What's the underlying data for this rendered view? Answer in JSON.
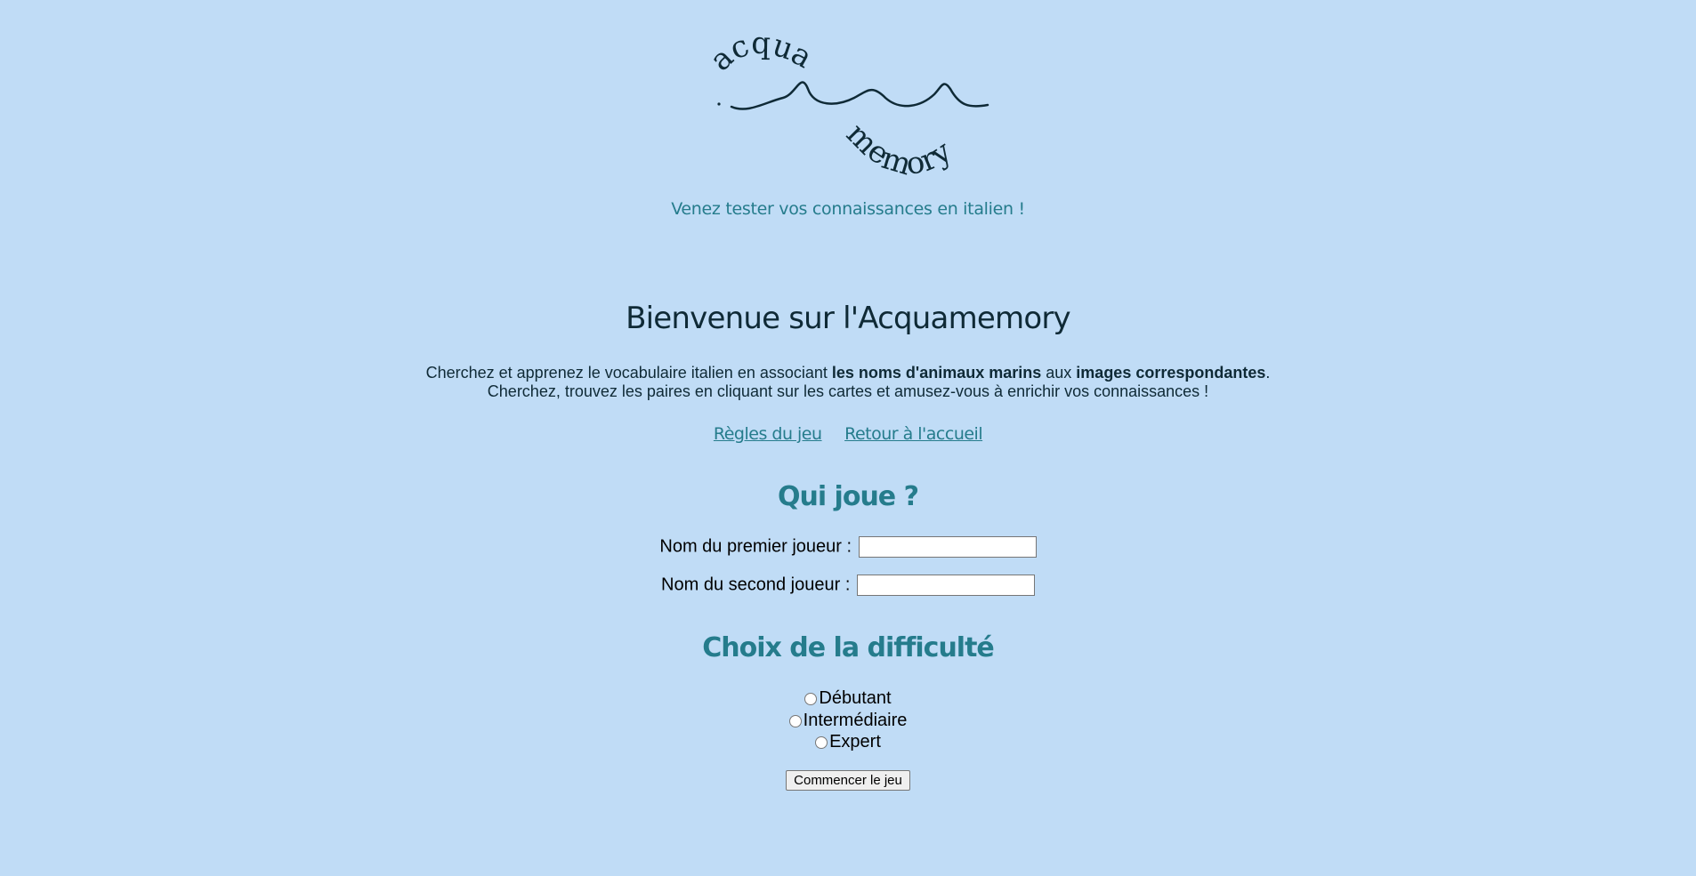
{
  "logo": {
    "word_top": "acqua",
    "word_bottom": "memory"
  },
  "tagline": "Venez tester vos connaissances en italien !",
  "welcome": {
    "title": "Bienvenue sur l'Acquamemory",
    "line1_part1": "Cherchez et apprenez le vocabulaire italien en associant ",
    "line1_bold1": "les noms d'animaux marins",
    "line1_part2": " aux ",
    "line1_bold2": "images correspondantes",
    "line1_end": ".",
    "line2": "Cherchez, trouvez les paires en cliquant sur les cartes et amusez-vous à enrichir vos connaissances !"
  },
  "nav": {
    "rules_label": "Règles du jeu",
    "home_label": "Retour à l'accueil"
  },
  "players": {
    "title": "Qui joue ?",
    "player1_label": "Nom du premier joueur :",
    "player1_value": "",
    "player2_label": "Nom du second joueur :",
    "player2_value": ""
  },
  "difficulty": {
    "title": "Choix de la difficulté",
    "options": [
      "Débutant",
      "Intermédiaire",
      "Expert"
    ]
  },
  "start_label": "Commencer le jeu",
  "colors": {
    "background": "#c0dcf6",
    "accent": "#257c8c",
    "text_dark": "#0f2a36"
  }
}
